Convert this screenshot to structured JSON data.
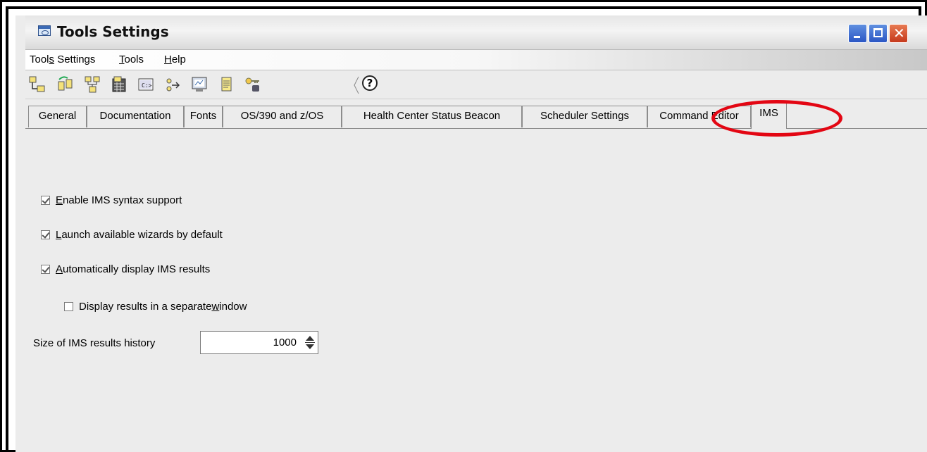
{
  "window": {
    "title": "Tools Settings",
    "icon": "tools-settings-window-icon"
  },
  "menubar": {
    "items": [
      {
        "label_pre": "Tool",
        "label_ul": "s",
        "label_post": " Settings"
      },
      {
        "label_pre": "",
        "label_ul": "T",
        "label_post": "ools"
      },
      {
        "label_pre": "",
        "label_ul": "H",
        "label_post": "elp"
      }
    ]
  },
  "toolbar": {
    "icons": [
      "control-center-icon",
      "replication-center-icon",
      "satellite-admin-icon",
      "task-center-icon",
      "command-editor-icon",
      "health-center-icon",
      "journal-icon",
      "notebook-icon",
      "license-center-icon",
      "tools-settings-icon"
    ],
    "help_glyph": "?"
  },
  "tabs": [
    {
      "label": "General",
      "active": false
    },
    {
      "label": "Documentation",
      "active": false
    },
    {
      "label": "Fonts",
      "active": false
    },
    {
      "label": "OS/390 and z/OS",
      "active": false
    },
    {
      "label": "Health Center Status Beacon",
      "active": false
    },
    {
      "label": "Scheduler Settings",
      "active": false
    },
    {
      "label": "Command Editor",
      "active": false
    },
    {
      "label": "IMS",
      "active": true
    }
  ],
  "ims": {
    "enable_syntax": {
      "pre": "",
      "ul": "E",
      "post": "nable IMS syntax support",
      "checked": true
    },
    "launch_wizards": {
      "pre": "",
      "ul": "L",
      "post": "aunch available wizards by default",
      "checked": true
    },
    "auto_display": {
      "pre": "",
      "ul": "A",
      "post": "utomatically display IMS results",
      "checked": true
    },
    "separate_window": {
      "pre": "Display results in a separate ",
      "ul": "w",
      "post": "indow",
      "checked": false
    },
    "history_label": "Size of IMS results history",
    "history_value": "1000"
  },
  "colors": {
    "annotation_oval": "#e30613",
    "window_frame": "#1b2c8f"
  }
}
